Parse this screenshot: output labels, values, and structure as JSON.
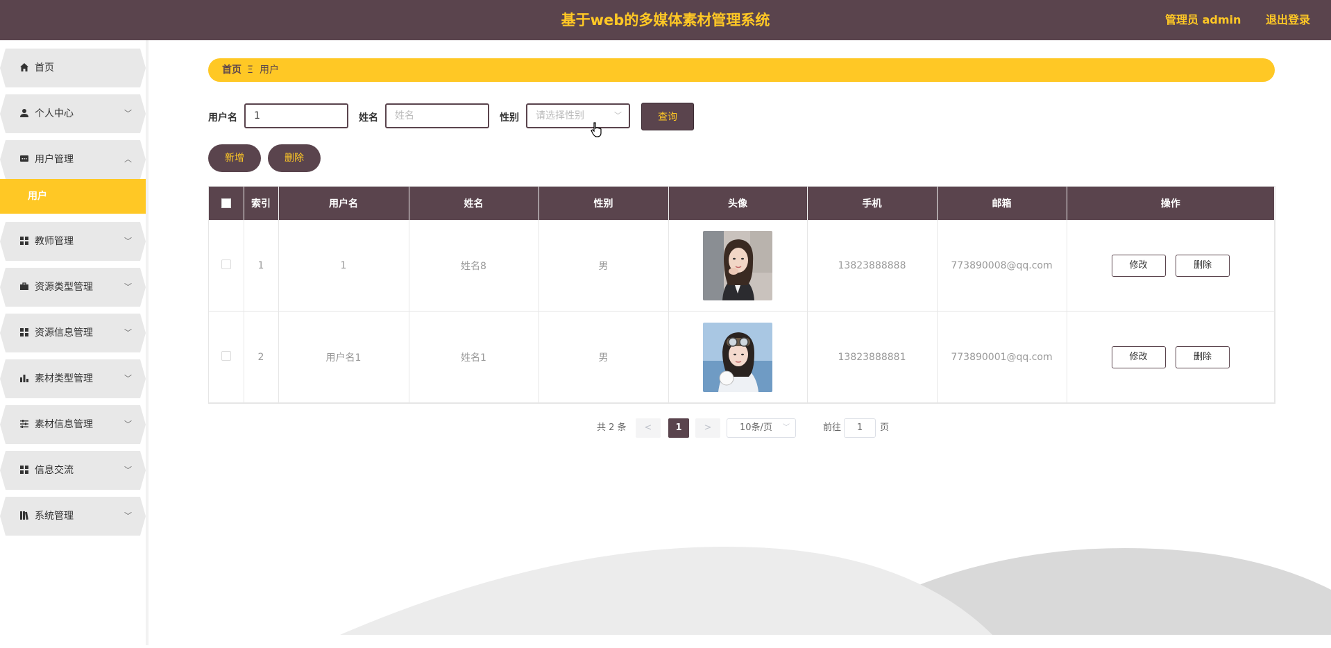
{
  "header": {
    "title": "基于web的多媒体素材管理系统",
    "user_label": "管理员 admin",
    "logout_label": "退出登录"
  },
  "sidebar": {
    "items": [
      {
        "label": "首页",
        "icon": "home-icon"
      },
      {
        "label": "个人中心",
        "icon": "user-icon"
      },
      {
        "label": "用户管理",
        "icon": "chat-icon"
      },
      {
        "label": "教师管理",
        "icon": "grid-icon"
      },
      {
        "label": "资源类型管理",
        "icon": "briefcase-icon"
      },
      {
        "label": "资源信息管理",
        "icon": "grid-icon"
      },
      {
        "label": "素材类型管理",
        "icon": "bar-chart-icon"
      },
      {
        "label": "素材信息管理",
        "icon": "sliders-icon"
      },
      {
        "label": "信息交流",
        "icon": "grid-icon"
      },
      {
        "label": "系统管理",
        "icon": "book-icon"
      }
    ],
    "active_sub": "用户"
  },
  "breadcrumb": {
    "home": "首页",
    "separator": "Ξ",
    "current": "用户"
  },
  "search": {
    "username_label": "用户名",
    "username_value": "1",
    "name_label": "姓名",
    "name_placeholder": "姓名",
    "gender_label": "性别",
    "gender_placeholder": "请选择性别",
    "query_label": "查询"
  },
  "actions": {
    "add_label": "新增",
    "delete_label": "删除"
  },
  "table": {
    "columns": [
      "索引",
      "用户名",
      "姓名",
      "性别",
      "头像",
      "手机",
      "邮箱",
      "操作"
    ],
    "rows": [
      {
        "index": "1",
        "username": "1",
        "name": "姓名8",
        "gender": "男",
        "phone": "13823888888",
        "email": "773890008@qq.com"
      },
      {
        "index": "2",
        "username": "用户名1",
        "name": "姓名1",
        "gender": "男",
        "phone": "13823888881",
        "email": "773890001@qq.com"
      }
    ],
    "edit_label": "修改",
    "delete_label": "删除"
  },
  "pagination": {
    "total": "共 2 条",
    "prev": "<",
    "current_page": "1",
    "next": ">",
    "page_size": "10条/页",
    "goto_label": "前往",
    "goto_value": "1",
    "page_suffix": "页"
  },
  "colors": {
    "primary": "#5a444d",
    "accent": "#ffc825"
  }
}
